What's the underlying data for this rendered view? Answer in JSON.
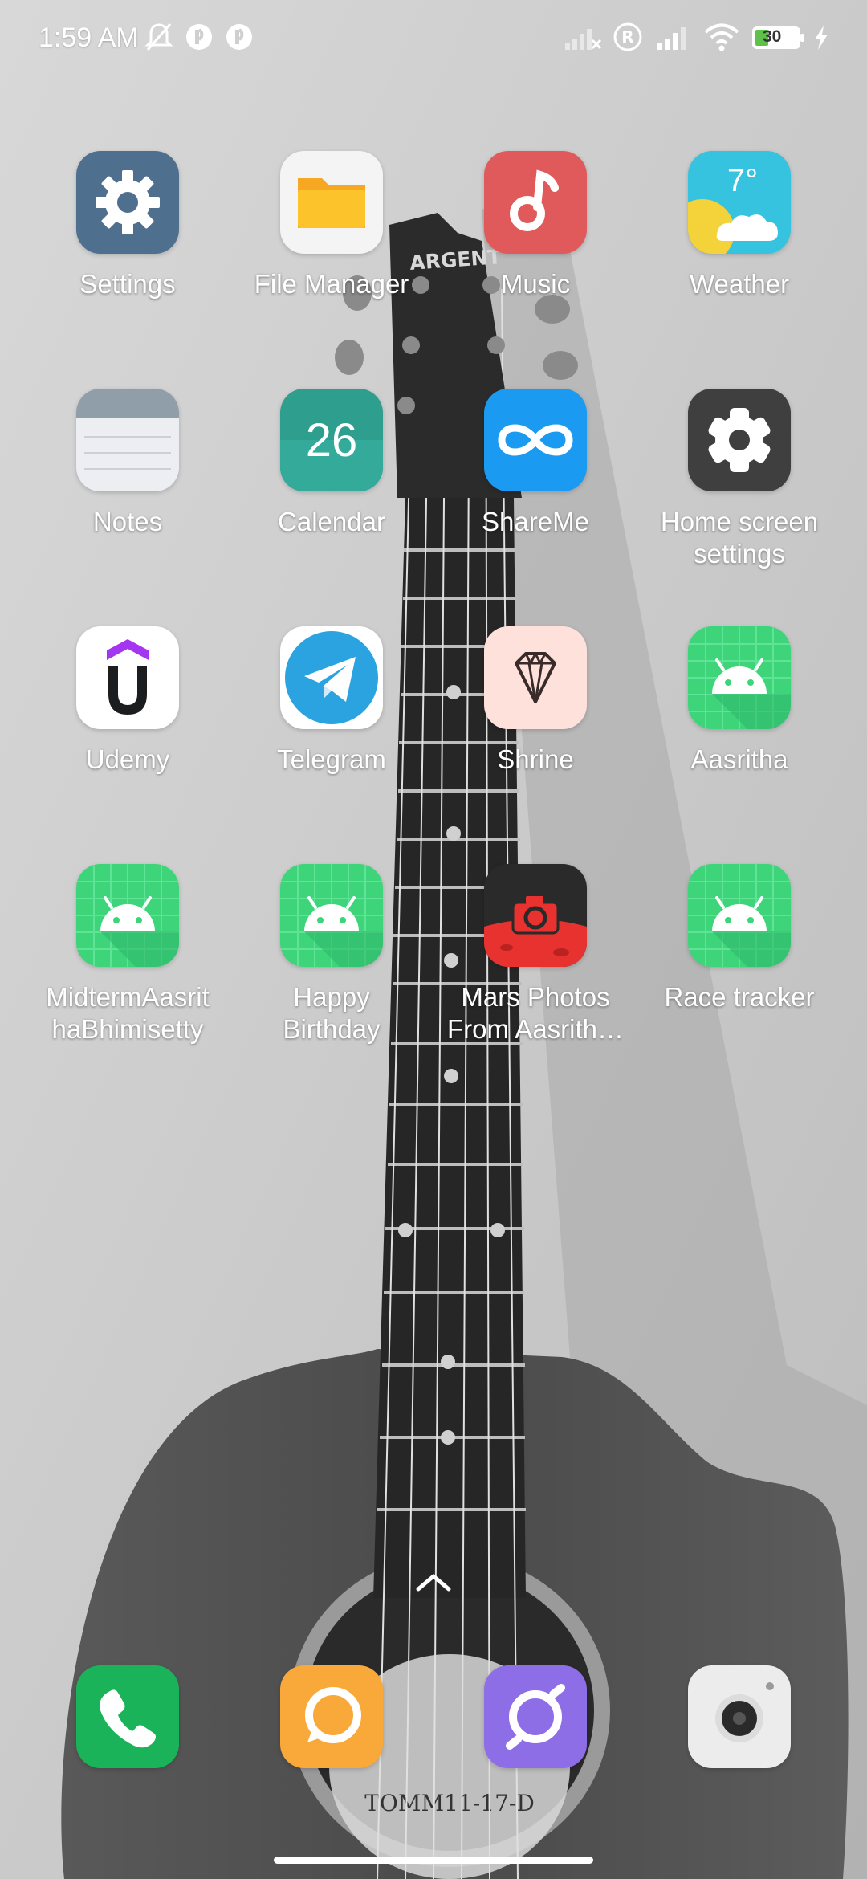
{
  "status_bar": {
    "time": "1:59 AM",
    "battery_level": "30",
    "icons": [
      "mute-icon",
      "notification-icon",
      "notification-icon",
      "signal-off-icon",
      "roaming-icon",
      "signal-icon",
      "wifi-icon",
      "battery-icon",
      "charging-icon"
    ]
  },
  "apps": [
    {
      "label": "Settings",
      "icon": "settings-icon"
    },
    {
      "label": "File Manager",
      "icon": "folder-icon"
    },
    {
      "label": "Music",
      "icon": "music-note-icon"
    },
    {
      "label": "Weather",
      "icon": "weather-icon",
      "text": "7°"
    },
    {
      "label": "Notes",
      "icon": "notes-icon"
    },
    {
      "label": "Calendar",
      "icon": "calendar-icon",
      "text": "26"
    },
    {
      "label": "ShareMe",
      "icon": "infinity-icon"
    },
    {
      "label": "Home screen\nsettings",
      "icon": "gear-icon"
    },
    {
      "label": "Udemy",
      "icon": "udemy-icon"
    },
    {
      "label": "Telegram",
      "icon": "paper-plane-icon"
    },
    {
      "label": "Shrine",
      "icon": "diamond-icon"
    },
    {
      "label": "Aasritha",
      "icon": "android-icon"
    },
    {
      "label": "MidtermAasrit\nhaBhimisetty",
      "icon": "android-icon"
    },
    {
      "label": "Happy\nBirthday",
      "icon": "android-icon"
    },
    {
      "label": "Mars Photos\nFrom Aasrith…",
      "icon": "camera-icon"
    },
    {
      "label": "Race tracker",
      "icon": "android-icon"
    }
  ],
  "dock": [
    {
      "icon": "phone-icon"
    },
    {
      "icon": "messages-icon"
    },
    {
      "icon": "browser-icon"
    },
    {
      "icon": "camera-icon"
    }
  ],
  "wallpaper": {
    "headstock_text": "ARGENT",
    "label_text": "TOMM11-17-D"
  },
  "colors": {
    "settings": "#4f6f8f",
    "music": "#e05a5c",
    "weather": "#35c3e0",
    "calendar": "#2e9e8e",
    "shareme": "#1a9af0",
    "android": "#3ed47a",
    "phone": "#1bb35a",
    "messages": "#f9a83a",
    "browser": "#8e6ee6"
  }
}
